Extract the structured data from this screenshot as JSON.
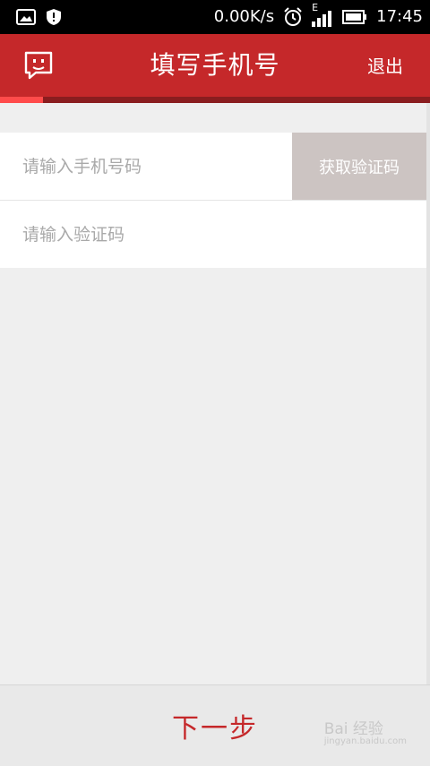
{
  "status_bar": {
    "network_speed": "0.00K/s",
    "time": "17:45",
    "signal_label": "E",
    "icons": [
      "image-icon",
      "shield-icon",
      "alarm-icon",
      "signal-icon",
      "battery-icon"
    ]
  },
  "app_bar": {
    "title": "填写手机号",
    "logout_label": "退出",
    "chat_icon": "chat-bubble-icon",
    "accent_color": "#c5282a"
  },
  "progress": {
    "value": 0.1
  },
  "form": {
    "phone_placeholder": "请输入手机号码",
    "get_code_label": "获取验证码",
    "code_placeholder": "请输入验证码"
  },
  "bottom": {
    "next_label": "下一步",
    "watermark_text": "Bai 经验",
    "watermark_sub": "jingyan.baidu.com"
  }
}
